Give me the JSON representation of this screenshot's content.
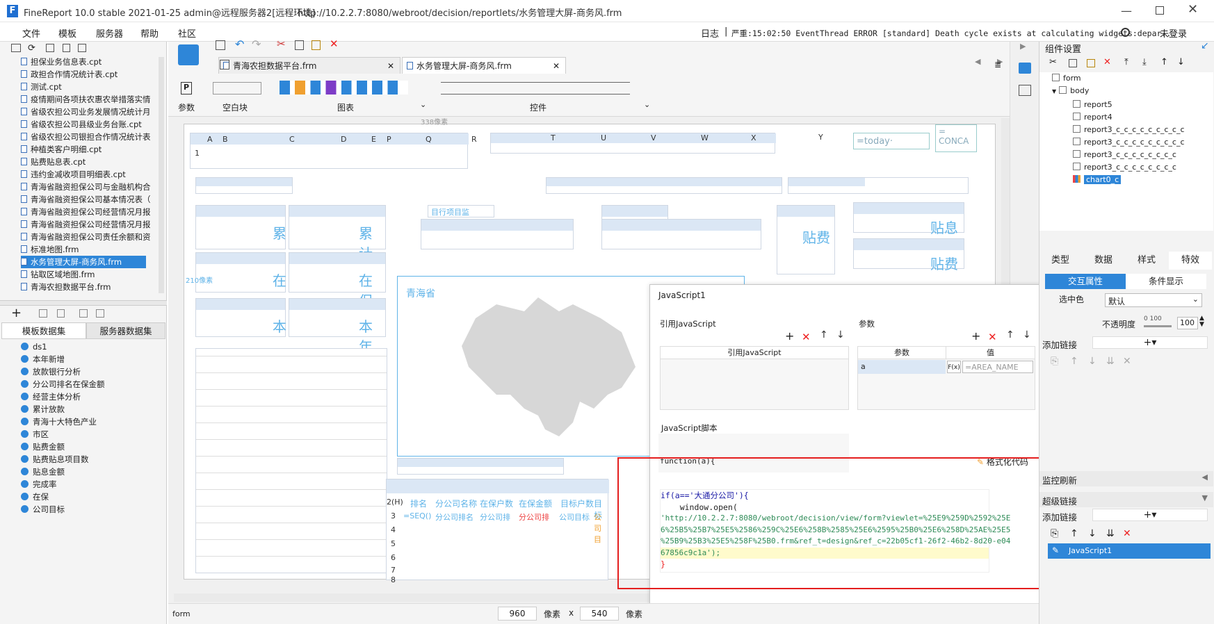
{
  "titlebar": {
    "title": "FineReport 10.0 stable 2021-01-25 admin@远程服务器2[远程环境]",
    "url": "http://10.2.2.7:8080/webroot/decision/reportlets/水务管理大屏-商务风.frm"
  },
  "menubar": {
    "items": [
      "文件",
      "模板",
      "服务器",
      "帮助",
      "社区"
    ],
    "log_label": "日志",
    "error_text": "严重:15:02:50 EventThread ERROR [standard] Death cycle exists at calculating widgets:depar...",
    "login_label": "未登录"
  },
  "file_tree": {
    "items": [
      "担保业务信息表.cpt",
      "政担合作情况统计表.cpt",
      "测试.cpt",
      "疫情期间各项扶农惠农举措落实情",
      "省级农担公司业务发展情况统计月",
      "省级农担公司县级业务台账.cpt",
      "省级农担公司银担合作情况统计表",
      "种植类客户明细.cpt",
      "贴费贴息表.cpt",
      "违约金减收项目明细表.cpt",
      "青海省融资担保公司与金融机构合",
      "青海省融资担保公司基本情况表（",
      "青海省融资担保公司经营情况月报",
      "青海省融资担保公司经营情况月报",
      "青海省融资担保公司责任余额和资",
      "标准地图.frm",
      "水务管理大屏-商务风.frm",
      "钻取区域地图.frm",
      "青海农担数据平台.frm"
    ],
    "selected_index": 16
  },
  "dataset_tabs": {
    "template": "模板数据集",
    "server": "服务器数据集"
  },
  "datasets": [
    "ds1",
    "本年新增",
    "放款银行分析",
    "分公司排名在保金额",
    "经营主体分析",
    "累计放款",
    "青海十大特色产业",
    "市区",
    "贴费金额",
    "贴费贴息项目数",
    "贴息金额",
    "完成率",
    "在保",
    "公司目标"
  ],
  "tabs": [
    "青海农担数据平台.frm",
    "水务管理大屏-商务风.frm"
  ],
  "toolbar": {
    "param_label": "参数",
    "blank_label": "空白块",
    "chart_label": "图表",
    "widget_label": "控件"
  },
  "canvas": {
    "px_label": "338像素",
    "px_label2": "210像素",
    "map_title": "青海省",
    "today": "=today·",
    "concat": "=\nCONCA",
    "big_words": [
      "累",
      "累计",
      "在",
      "在保",
      "本",
      "本年",
      "贴费",
      "贴息",
      "贴费"
    ],
    "cols_row1": [
      "A",
      "B",
      "C",
      "D",
      "E",
      "P",
      "Q",
      "R",
      "T",
      "U",
      "V",
      "W",
      "X",
      "Y"
    ],
    "table_headers": [
      "排名",
      "分公司名称",
      "在保户数",
      "在保金额",
      "目标户数",
      "目标"
    ],
    "table_row3": [
      "=SEQ()",
      "分公司排名",
      "分公司排",
      "分公司排",
      "公司目标",
      "公司目"
    ],
    "row_nums": [
      "2(H)",
      "3",
      "4",
      "5",
      "6",
      "7",
      "8"
    ],
    "project_label": "目行项目监"
  },
  "dialog": {
    "title": "JavaScript1",
    "ref_js_label": "引用JavaScript",
    "params_label": "参数",
    "col_ref": "引用JavaScript",
    "col_param": "参数",
    "col_value": "值",
    "param_name": "a",
    "param_value": "=AREA_NAME",
    "fx": "F(x)",
    "script_label": "JavaScript脚本",
    "format_label": "格式化代码",
    "fn_sig": "function(a){",
    "code_lines": [
      "if(a=='大通分公司'){",
      "    window.open(",
      "'http://10.2.2.7:8080/webroot/decision/view/form?viewlet=%25E9%259D%2592%25E",
      "6%25B5%25B7%25E5%2586%259C%25E6%258B%2585%25E6%2595%25B0%25E6%258D%25AE%25E5",
      "%25B9%25B3%25E5%258F%25B0.frm&ref_t=design&ref_c=22b05cf1-26f2-46b2-8d20-e04",
      "67856c9c1a');",
      "}"
    ],
    "close_brace": "}"
  },
  "rightpane": {
    "title": "组件设置",
    "tree": [
      "form",
      "body",
      "report5",
      "report4",
      "report3_c_c_c_c_c_c_c_c_c",
      "report3_c_c_c_c_c_c_c_c_c",
      "report3_c_c_c_c_c_c_c_c",
      "report3_c_c_c_c_c_c_c_c",
      "chart0_c"
    ],
    "tabs": [
      "类型",
      "数据",
      "样式",
      "特效"
    ],
    "subtabs": [
      "交互属性",
      "条件显示"
    ],
    "select_color_label": "选中色",
    "select_color_value": "默认",
    "opacity_label": "不透明度",
    "opacity_scale": "0 100",
    "opacity_value": "100",
    "add_link_label": "添加链接",
    "monitor_label": "监控刷新",
    "hyperlink_label": "超级链接",
    "add_link_label2": "添加链接",
    "js_item": "JavaScript1"
  },
  "statusbar": {
    "left": "form",
    "width": "960",
    "px1": "像素",
    "x": "x",
    "height": "540",
    "px2": "像素"
  }
}
